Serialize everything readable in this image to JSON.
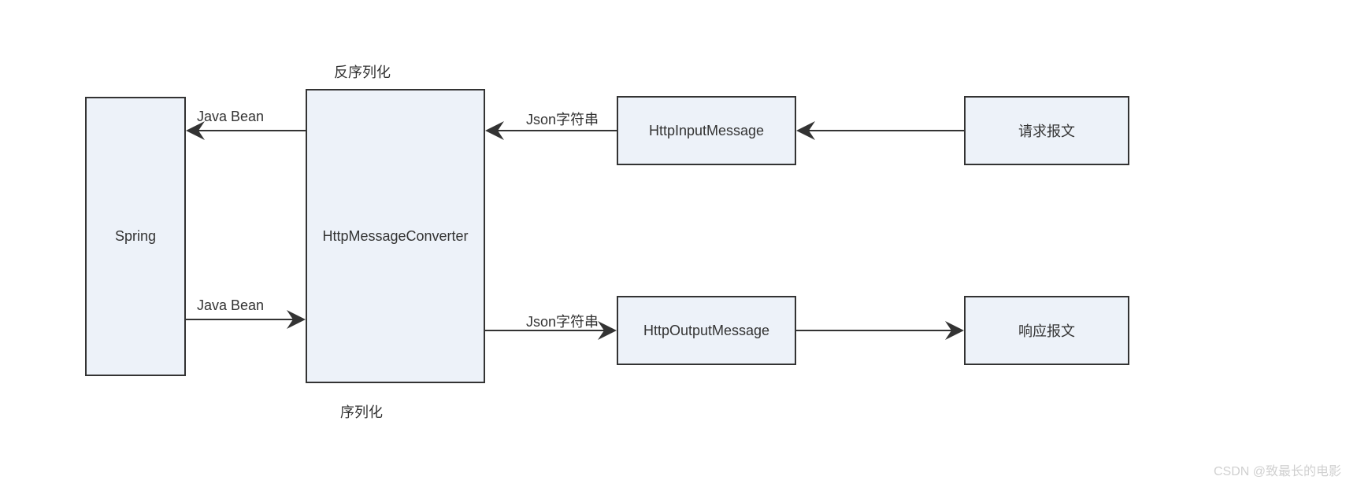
{
  "boxes": {
    "spring": "Spring",
    "converter": "HttpMessageConverter",
    "input": "HttpInputMessage",
    "output": "HttpOutputMessage",
    "request": "请求报文",
    "response": "响应报文"
  },
  "labels": {
    "top_header": "反序列化",
    "bottom_header": "序列化",
    "javabean_top": "Java Bean",
    "javabean_bottom": "Java Bean",
    "json_top": "Json字符串",
    "json_bottom": "Json字符串"
  },
  "watermark": "CSDN @致最长的电影"
}
